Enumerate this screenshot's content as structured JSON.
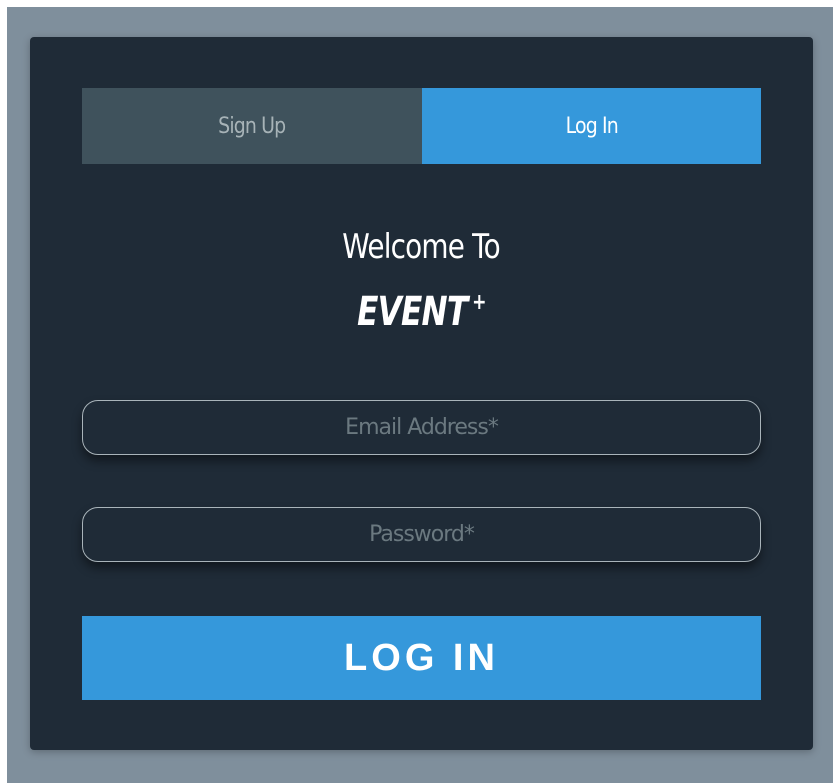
{
  "tabs": {
    "signup_label": "Sign Up",
    "login_label": "Log In",
    "active": "Log In"
  },
  "heading": {
    "welcome": "Welcome To",
    "brand": "EVENT",
    "brand_mark": "+"
  },
  "form": {
    "email_placeholder": "Email Address*",
    "password_placeholder": "Password*",
    "submit_label": "LOG IN"
  },
  "colors": {
    "background": "#7f8f9c",
    "card": "#1f2b37",
    "accent": "#3598db",
    "inactive_tab": "#3f525c"
  }
}
